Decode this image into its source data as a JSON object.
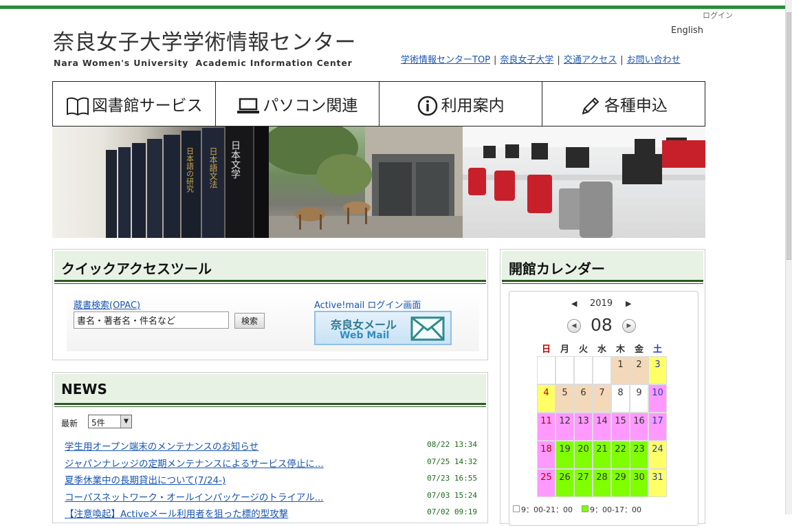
{
  "header": {
    "login": "ログイン",
    "english": "English",
    "title": "奈良女子大学学術情報センター",
    "subtitle": "Nara Women's University  Academic Information Center",
    "links": [
      "学術情報センターTOP",
      "奈良女子大学",
      "交通アクセス",
      "お問い合わせ"
    ],
    "separator": "|"
  },
  "nav": [
    {
      "label": "図書館サービス",
      "icon": "book-icon"
    },
    {
      "label": "パソコン関連",
      "icon": "laptop-icon"
    },
    {
      "label": "利用案内",
      "icon": "info-icon"
    },
    {
      "label": "各種申込",
      "icon": "pencil-icon"
    }
  ],
  "hero": {
    "book_spines": [
      "日本文学",
      "日本語文法",
      "日本語の研究"
    ]
  },
  "quick_access": {
    "title": "クイックアクセスツール",
    "opac_link": "蔵書検索(OPAC)",
    "search_value": "書名・著者名・件名など",
    "search_button": "検索",
    "activemail_label": "Active!mail ログイン画面",
    "mail_button_line1": "奈良女メール",
    "mail_button_line2": "Web Mail"
  },
  "news": {
    "title": "NEWS",
    "count_label": "最新",
    "count_value": "5件",
    "items": [
      {
        "title": "学生用オープン端末のメンテナンスのお知らせ",
        "date": "08/22 13:34"
      },
      {
        "title": "ジャパンナレッジの定期メンテナンスによるサービス停止に...",
        "date": "07/25 14:32"
      },
      {
        "title": "夏季休業中の長期貸出について(7/24-)",
        "date": "07/23 16:55"
      },
      {
        "title": "コーパスネットワーク・オールインパッケージのトライアル...",
        "date": "07/03 15:24"
      },
      {
        "title": "【注意喚起】Activeメール利用者を狙った標的型攻撃",
        "date": "07/02 09:19"
      }
    ]
  },
  "calendar": {
    "title": "開館カレンダー",
    "year": "2019",
    "month": "08",
    "weekdays": [
      "日",
      "月",
      "火",
      "水",
      "木",
      "金",
      "土"
    ],
    "weekday_colors": [
      "#c00000",
      "#333333",
      "#333333",
      "#333333",
      "#333333",
      "#333333",
      "#1f3fbf"
    ],
    "colors": {
      "empty": "#ffffff",
      "tan": "#f3d9b9",
      "yellow": "#ffff66",
      "white": "#ffffff",
      "pink": "#ff99ff",
      "green": "#7fff00"
    },
    "days": [
      {
        "d": "",
        "c": "empty"
      },
      {
        "d": "",
        "c": "empty"
      },
      {
        "d": "",
        "c": "empty"
      },
      {
        "d": "",
        "c": "empty"
      },
      {
        "d": "1",
        "c": "tan"
      },
      {
        "d": "2",
        "c": "tan"
      },
      {
        "d": "3",
        "c": "yellow"
      },
      {
        "d": "4",
        "c": "yellow"
      },
      {
        "d": "5",
        "c": "tan"
      },
      {
        "d": "6",
        "c": "tan"
      },
      {
        "d": "7",
        "c": "tan"
      },
      {
        "d": "8",
        "c": "white"
      },
      {
        "d": "9",
        "c": "white"
      },
      {
        "d": "10",
        "c": "pink"
      },
      {
        "d": "11",
        "c": "pink"
      },
      {
        "d": "12",
        "c": "pink"
      },
      {
        "d": "13",
        "c": "pink"
      },
      {
        "d": "14",
        "c": "pink"
      },
      {
        "d": "15",
        "c": "pink"
      },
      {
        "d": "16",
        "c": "pink"
      },
      {
        "d": "17",
        "c": "pink"
      },
      {
        "d": "18",
        "c": "pink"
      },
      {
        "d": "19",
        "c": "green"
      },
      {
        "d": "20",
        "c": "green"
      },
      {
        "d": "21",
        "c": "green"
      },
      {
        "d": "22",
        "c": "green"
      },
      {
        "d": "23",
        "c": "green"
      },
      {
        "d": "24",
        "c": "yellow"
      },
      {
        "d": "25",
        "c": "pink"
      },
      {
        "d": "26",
        "c": "green"
      },
      {
        "d": "27",
        "c": "green"
      },
      {
        "d": "28",
        "c": "green"
      },
      {
        "d": "29",
        "c": "green"
      },
      {
        "d": "30",
        "c": "green"
      },
      {
        "d": "31",
        "c": "yellow"
      }
    ],
    "legend": [
      {
        "label": "9：00-21：00",
        "c": "white"
      },
      {
        "label": "9：00-17：00",
        "c": "green"
      }
    ]
  }
}
